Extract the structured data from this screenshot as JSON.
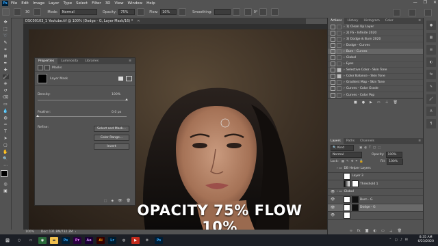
{
  "menu": {
    "app_icon": "Ps",
    "items": [
      "File",
      "Edit",
      "Image",
      "Layer",
      "Type",
      "Select",
      "Filter",
      "3D",
      "View",
      "Window",
      "Help"
    ]
  },
  "window_controls": {
    "minimize": "—",
    "restore": "❐",
    "close": "✕"
  },
  "options_bar": {
    "brush_size": "30",
    "mode_label": "Mode:",
    "mode_value": "Normal",
    "opacity_label": "Opacity:",
    "opacity_value": "75%",
    "flow_label": "Flow:",
    "flow_value": "10%",
    "smoothing_label": "Smoothing:",
    "smoothing_value": "",
    "angle_value": "0°"
  },
  "document": {
    "tab_title": "DSC00103_1 Youtube.tif @ 100% (Dodge - G, Layer Mask/16) *",
    "zoom": "100%",
    "doc_info": "Doc: 131.8M/732.3M"
  },
  "properties": {
    "tabs": [
      "Properties",
      "Luminosity",
      "Libraries"
    ],
    "masks_label": "Masks",
    "layer_mask_label": "Layer Mask",
    "density_label": "Density:",
    "density_value": "100%",
    "density_level": 1.0,
    "feather_label": "Feather:",
    "feather_value": "0.0 px",
    "feather_level": 0.0,
    "refine_label": "Refine:",
    "buttons": [
      "Select and Mask...",
      "Color Range...",
      "Invert"
    ]
  },
  "actions_panel": {
    "tabs": [
      "Actions",
      "History",
      "Histogram",
      "Color"
    ],
    "rows": [
      {
        "label": "1) Clean Up Layer",
        "dialog": false
      },
      {
        "label": "2) FS - Infinite 2020",
        "dialog": false
      },
      {
        "label": "3) Dodge & Burn 2020",
        "dialog": false
      },
      {
        "label": "Dodge - Curves",
        "dialog": false
      },
      {
        "label": "Burn - Curves",
        "dialog": false,
        "selected": true
      },
      {
        "label": "Global",
        "dialog": false
      },
      {
        "label": "Eyes",
        "dialog": false
      },
      {
        "label": "Selective Color - Skin Tone",
        "dialog": true
      },
      {
        "label": "Color Balance - Skin Tone",
        "dialog": true
      },
      {
        "label": "Gradient Map - Skin Tone",
        "dialog": false
      },
      {
        "label": "Curves - Color Grade",
        "dialog": false
      },
      {
        "label": "Curves - Color Pop",
        "dialog": false
      }
    ]
  },
  "layers_panel": {
    "tabs": [
      "Layers",
      "Paths",
      "Channels"
    ],
    "kind_label": "Kind",
    "blend_mode": "Normal",
    "opacity_label": "Opacity:",
    "opacity_value": "100%",
    "lock_label": "Lock:",
    "fill_label": "Fill:",
    "fill_value": "100%",
    "rows": [
      {
        "label": "DB Helper Layers",
        "type": "group",
        "visible": false
      },
      {
        "label": "Layer 3",
        "type": "layer",
        "visible": false
      },
      {
        "label": "Threshold 1",
        "type": "adjustment",
        "visible": false
      },
      {
        "label": "Global",
        "type": "group",
        "visible": true
      },
      {
        "label": "Burn - G",
        "type": "mask",
        "visible": true
      },
      {
        "label": "Dodge - G",
        "type": "mask",
        "visible": true,
        "selected": true
      },
      {
        "label": "",
        "type": "layer",
        "visible": true
      }
    ]
  },
  "caption": "OPACITY 75% FLOW 10%",
  "taskbar": {
    "time": "8:35 AM",
    "date": "6/23/2020",
    "apps": [
      "Ps",
      "Pr",
      "Ae",
      "Ai",
      "Lr",
      "Ps"
    ]
  },
  "colors": {
    "ui_background": "#535353",
    "panel_dark": "#424242",
    "taskbar": "#1c1f26",
    "ps_blue": "#31a8ff",
    "caption_text": "#ffffff"
  }
}
